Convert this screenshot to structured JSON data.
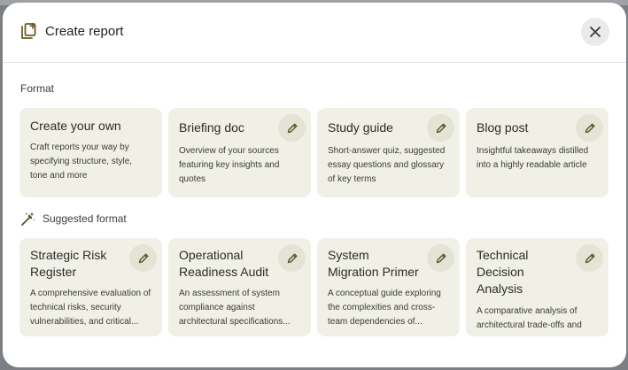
{
  "dialog": {
    "title": "Create report",
    "close_icon": "close-icon",
    "header_icon": "report-add-icon"
  },
  "format_section": {
    "label": "Format",
    "cards": [
      {
        "title": "Create your own",
        "description": "Craft reports your way by specifying structure, style, tone and more",
        "editable": false
      },
      {
        "title": "Briefing doc",
        "description": "Overview of your sources featuring key insights and quotes",
        "editable": true
      },
      {
        "title": "Study guide",
        "description": "Short-answer quiz, suggested essay questions and glossary of key terms",
        "editable": true
      },
      {
        "title": "Blog post",
        "description": "Insightful takeaways distilled into a highly readable article",
        "editable": true
      }
    ]
  },
  "suggested_section": {
    "label": "Suggested format",
    "icon": "magic-wand-icon",
    "cards": [
      {
        "title": "Strategic Risk Register",
        "description": "A comprehensive evaluation of technical risks, security vulnerabilities, and critical...",
        "editable": true
      },
      {
        "title": "Operational Readiness Audit",
        "description": "An assessment of system compliance against architectural specifications...",
        "editable": true
      },
      {
        "title": "System Migration Primer",
        "description": "A conceptual guide exploring the complexities and cross-team dependencies of...",
        "editable": true
      },
      {
        "title": "Technical Decision Analysis",
        "description": "A comparative analysis of architectural trade-offs and",
        "editable": true
      }
    ]
  },
  "colors": {
    "card_background": "#f0f0e7",
    "edit_button_background": "#e3e3d6",
    "edit_icon": "#5b5226"
  }
}
